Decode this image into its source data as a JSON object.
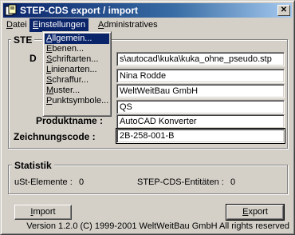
{
  "window": {
    "title": "STEP-CDS export / import",
    "close_label": "✕"
  },
  "menu": {
    "items": [
      {
        "label": "Datei",
        "accel": "D"
      },
      {
        "label": "Einstellungen",
        "accel": "E"
      },
      {
        "label": "Administratives",
        "accel": "A"
      }
    ]
  },
  "dropdown": {
    "items": [
      {
        "accel": "A",
        "rest": "llgemein..."
      },
      {
        "accel": "E",
        "rest": "benen..."
      },
      {
        "accel": "S",
        "rest": "chriftarten..."
      },
      {
        "accel": "L",
        "rest": "inienarten..."
      },
      {
        "accel": "S",
        "rest": "chraffur..."
      },
      {
        "accel": "M",
        "rest": "uster..."
      },
      {
        "accel": "P",
        "rest": "unktsymbole..."
      }
    ]
  },
  "step_group": {
    "title_visible": "STE",
    "label_partial": "D",
    "label_produktname": "Produktname :",
    "label_zeichnungscode": "Zeichnungscode :",
    "fields": [
      "s\\autocad\\kuka\\kuka_ohne_pseudo.stp",
      "Nina Rodde",
      "WeltWeitBau GmbH",
      "",
      "QS",
      "AutoCAD Konverter",
      "2B-258-001-B"
    ]
  },
  "stats": {
    "title": "Statistik",
    "ust_label": "uSt-Elemente :",
    "ust_value": "0",
    "cds_label": "STEP-CDS-Entitäten :",
    "cds_value": "0"
  },
  "buttons": {
    "import_label": "Import",
    "export_label": "Export"
  },
  "footer": {
    "text": "Version 1.2.0  (C) 1999-2001 WeltWeitBau GmbH All rights reserved"
  }
}
